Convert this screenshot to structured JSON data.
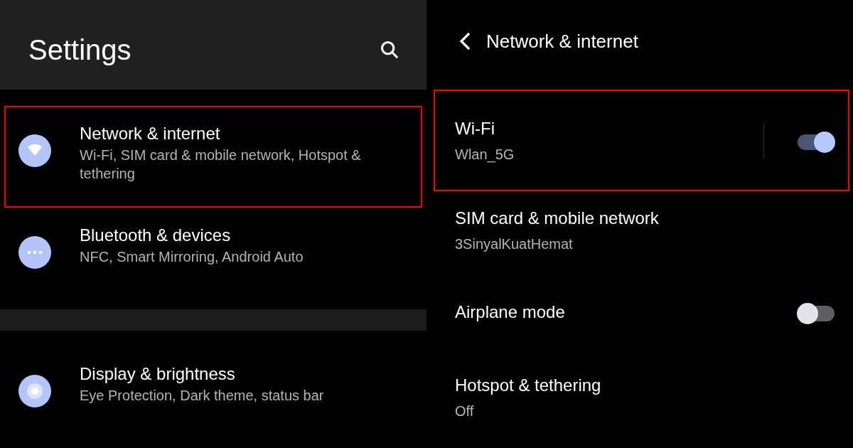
{
  "settings": {
    "title": "Settings",
    "groups": [
      [
        {
          "title": "Network & internet",
          "subtitle": "Wi-Fi, SIM card & mobile network, Hotspot & tethering",
          "highlighted": true
        },
        {
          "title": "Bluetooth & devices",
          "subtitle": "NFC, Smart Mirroring, Android Auto",
          "highlighted": false
        }
      ],
      [
        {
          "title": "Display & brightness",
          "subtitle": "Eye Protection, Dark theme, status bar",
          "highlighted": false
        }
      ]
    ]
  },
  "network": {
    "title": "Network & internet",
    "items": [
      {
        "kind": "toggle",
        "title": "Wi-Fi",
        "subtitle": "Wlan_5G",
        "on": true,
        "highlighted": true
      },
      {
        "kind": "plain",
        "title": "SIM card & mobile network",
        "subtitle": "3SinyalKuatHemat",
        "highlighted": false
      },
      {
        "kind": "toggle",
        "title": "Airplane mode",
        "on": false,
        "highlighted": false
      },
      {
        "kind": "plain",
        "title": "Hotspot & tethering",
        "subtitle": "Off",
        "highlighted": false
      }
    ]
  }
}
